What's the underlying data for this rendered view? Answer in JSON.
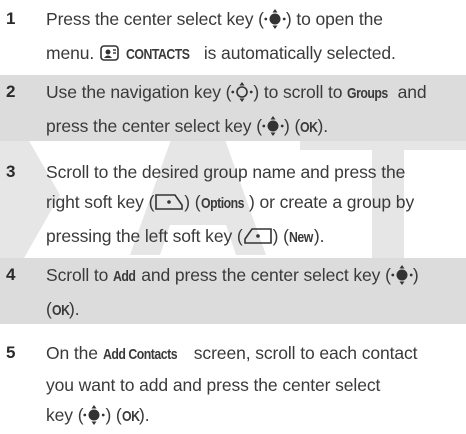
{
  "watermark": "DRAFT",
  "steps": [
    {
      "num": "1",
      "line1_a": "Press the center select key (",
      "line1_b": ") to open the",
      "line2_a": "menu.",
      "line2_ui": "CONTACTS",
      "line2_b": "is automatically selected."
    },
    {
      "num": "2",
      "line1_a": "Use the navigation key (",
      "line1_b": ") to scroll to",
      "line1_ui": "Groups",
      "line1_c": "and",
      "line2_a": "press the center select key (",
      "line2_b": ") (",
      "line2_ui": "OK",
      "line2_c": ")."
    },
    {
      "num": "3",
      "line1": "Scroll to the desired group name and press the",
      "line2_a": "right soft key (",
      "line2_b": ") (",
      "line2_ui": "Options",
      "line2_c": ") or create a group by",
      "line3_a": "pressing the left soft key (",
      "line3_b": ") (",
      "line3_ui": "New",
      "line3_c": ")."
    },
    {
      "num": "4",
      "line1_a": "Scroll to",
      "line1_ui": "Add",
      "line1_b": "and press the center select key (",
      "line1_c": ")",
      "line2_a": "(",
      "line2_ui": "OK",
      "line2_b": ")."
    },
    {
      "num": "5",
      "line1_a": "On the",
      "line1_ui": "Add Contacts",
      "line1_b": "screen, scroll to each contact",
      "line2": "you want to add and press the center select",
      "line3_a": "key (",
      "line3_b": ") (",
      "line3_ui": "OK",
      "line3_c": ")."
    }
  ],
  "icons": {
    "select_key": "center-select-key-icon",
    "nav_key": "navigation-key-icon",
    "contacts": "contacts-icon",
    "right_soft": "right-soft-key-icon",
    "left_soft": "left-soft-key-icon"
  }
}
